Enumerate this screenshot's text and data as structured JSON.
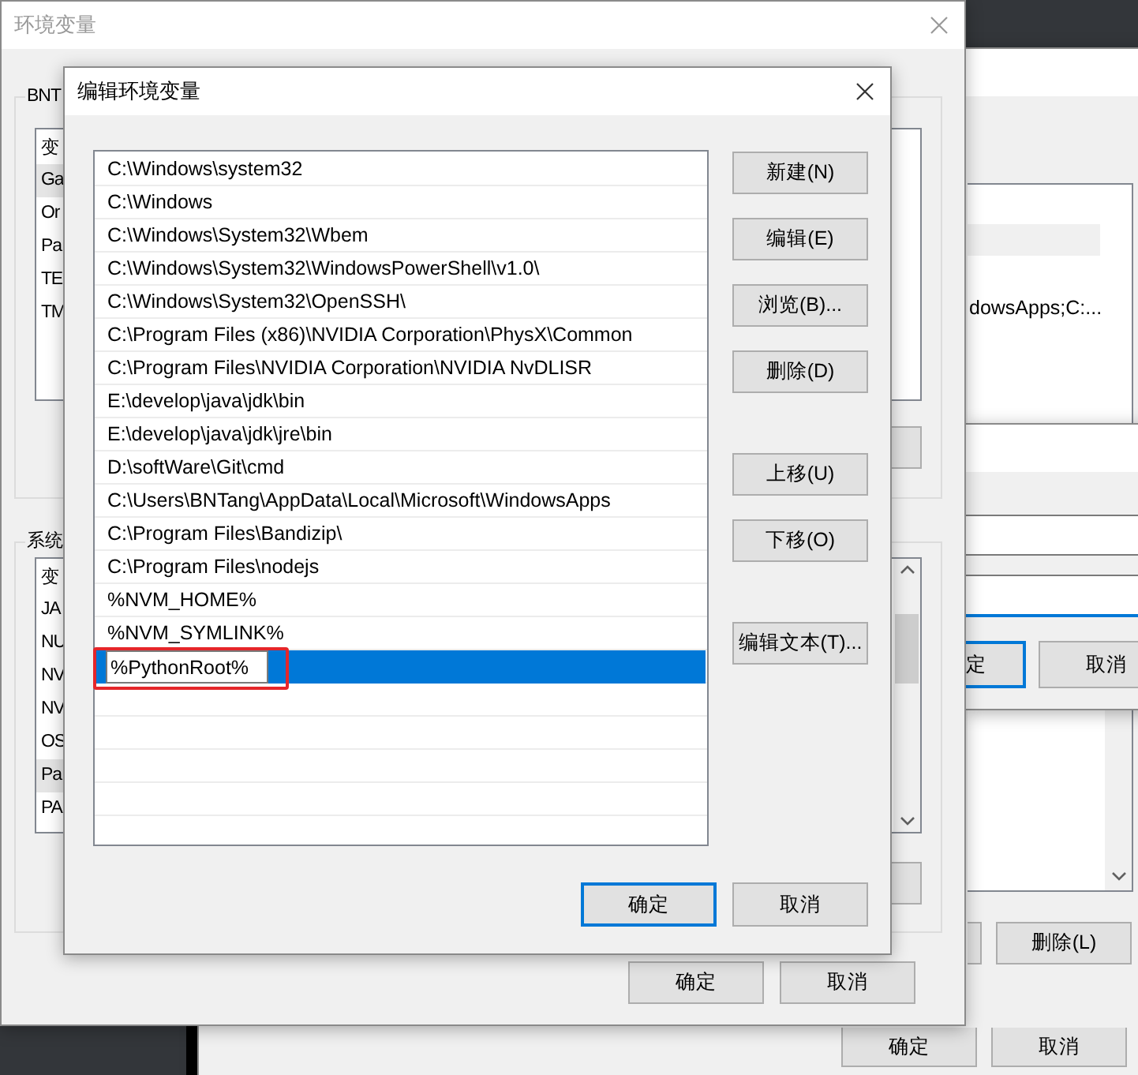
{
  "background_window": {
    "list_text": "dowsApps;C:...",
    "buttons": [
      {
        "label": "删除(L)"
      }
    ],
    "dialog_buttons": [
      {
        "label": "确定"
      },
      {
        "label": "取消"
      }
    ]
  },
  "partial_dialog": {
    "buttons": [
      {
        "label": "定",
        "focused": true
      },
      {
        "label": "取消",
        "focused": false
      }
    ]
  },
  "env_dialog": {
    "title": "环境变量",
    "user_group": {
      "title": "BNT",
      "header": "变",
      "rows": [
        {
          "text": "Ga",
          "selected": true
        },
        {
          "text": "Or",
          "selected": false
        },
        {
          "text": "Pa",
          "selected": false
        },
        {
          "text": "TE",
          "selected": false
        },
        {
          "text": "TM",
          "selected": false
        }
      ]
    },
    "system_group": {
      "title": "系统",
      "header": "变",
      "rows": [
        {
          "text": "JA",
          "selected": false
        },
        {
          "text": "NU",
          "selected": false
        },
        {
          "text": "NV",
          "selected": false
        },
        {
          "text": "NV",
          "selected": false
        },
        {
          "text": "OS",
          "selected": false
        },
        {
          "text": "Pa",
          "selected": true
        },
        {
          "text": "PA",
          "selected": false
        }
      ]
    },
    "buttons": [
      {
        "label": "确定"
      },
      {
        "label": "取消"
      }
    ]
  },
  "edit_dialog": {
    "title": "编辑环境变量",
    "entries": [
      {
        "text": "C:\\Windows\\system32",
        "selected": false,
        "editing": false,
        "highlighted": false
      },
      {
        "text": "C:\\Windows",
        "selected": false,
        "editing": false,
        "highlighted": false
      },
      {
        "text": "C:\\Windows\\System32\\Wbem",
        "selected": false,
        "editing": false,
        "highlighted": false
      },
      {
        "text": "C:\\Windows\\System32\\WindowsPowerShell\\v1.0\\",
        "selected": false,
        "editing": false,
        "highlighted": false
      },
      {
        "text": "C:\\Windows\\System32\\OpenSSH\\",
        "selected": false,
        "editing": false,
        "highlighted": false
      },
      {
        "text": "C:\\Program Files (x86)\\NVIDIA Corporation\\PhysX\\Common",
        "selected": false,
        "editing": false,
        "highlighted": false
      },
      {
        "text": "C:\\Program Files\\NVIDIA Corporation\\NVIDIA NvDLISR",
        "selected": false,
        "editing": false,
        "highlighted": false
      },
      {
        "text": "E:\\develop\\java\\jdk\\bin",
        "selected": false,
        "editing": false,
        "highlighted": false
      },
      {
        "text": "E:\\develop\\java\\jdk\\jre\\bin",
        "selected": false,
        "editing": false,
        "highlighted": false
      },
      {
        "text": "D:\\softWare\\Git\\cmd",
        "selected": false,
        "editing": false,
        "highlighted": false
      },
      {
        "text": "C:\\Users\\BNTang\\AppData\\Local\\Microsoft\\WindowsApps",
        "selected": false,
        "editing": false,
        "highlighted": false
      },
      {
        "text": "C:\\Program Files\\Bandizip\\",
        "selected": false,
        "editing": false,
        "highlighted": false
      },
      {
        "text": "C:\\Program Files\\nodejs",
        "selected": false,
        "editing": false,
        "highlighted": false
      },
      {
        "text": "%NVM_HOME%",
        "selected": false,
        "editing": false,
        "highlighted": false
      },
      {
        "text": "%NVM_SYMLINK%",
        "selected": false,
        "editing": false,
        "highlighted": false
      },
      {
        "text": "%PythonRoot%",
        "selected": true,
        "editing": true,
        "highlighted": true
      }
    ],
    "side_buttons": [
      [
        "新建(N)",
        "编辑(E)",
        "浏览(B)...",
        "删除(D)"
      ],
      [
        "上移(U)",
        "下移(O)"
      ],
      [
        "编辑文本(T)..."
      ]
    ],
    "buttons": [
      {
        "label": "确定",
        "focused": true
      },
      {
        "label": "取消",
        "focused": false
      }
    ]
  }
}
